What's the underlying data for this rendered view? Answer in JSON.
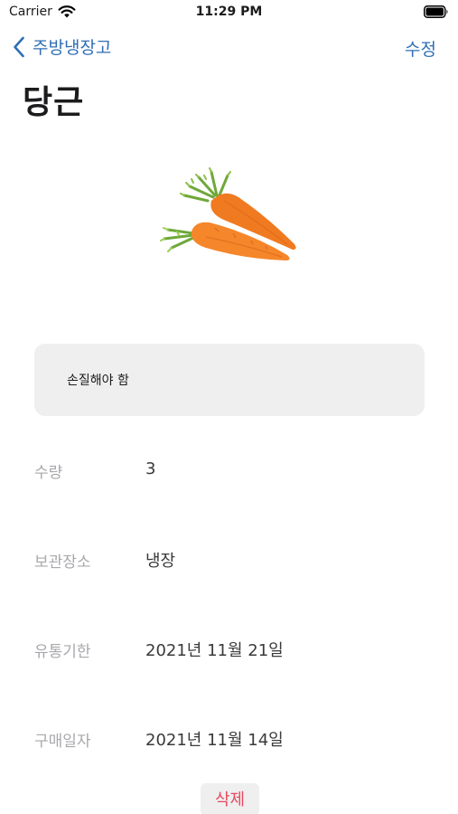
{
  "status_bar": {
    "carrier": "Carrier",
    "time": "11:29 PM"
  },
  "nav": {
    "back_label": "주방냉장고",
    "edit_label": "수정"
  },
  "item": {
    "title": "당근",
    "image": "carrot-image",
    "memo": "손질해야 함"
  },
  "fields": {
    "quantity": {
      "label": "수량",
      "value": "3"
    },
    "storage": {
      "label": "보관장소",
      "value": "냉장"
    },
    "expiry": {
      "label": "유통기한",
      "value": "2021년 11월 21일"
    },
    "purchase": {
      "label": "구매일자",
      "value": "2021년 11월 14일"
    }
  },
  "actions": {
    "delete_label": "삭제"
  },
  "colors": {
    "accent": "#2f6fb5",
    "destructive": "#e8485d",
    "memo_bg": "#efeff0",
    "label_gray": "#a8a8ad"
  }
}
